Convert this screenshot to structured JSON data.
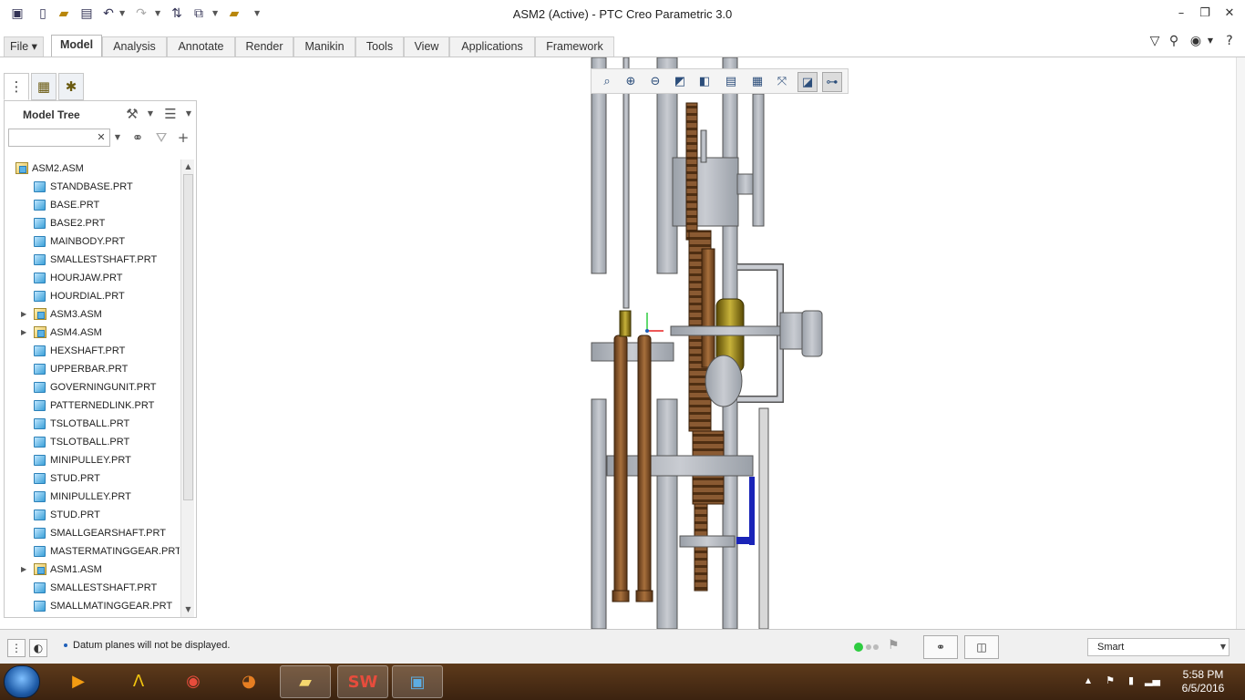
{
  "app": {
    "title": "ASM2 (Active) - PTC Creo Parametric 3.0"
  },
  "quick_access": {
    "icons": [
      "window-icon",
      "new-file-icon",
      "open-icon",
      "save-icon",
      "undo-icon",
      "redo-icon",
      "regenerate-icon",
      "windows-icon",
      "close-icon",
      "customize-icon"
    ]
  },
  "ribbon": {
    "tabs": [
      {
        "label": "File ▾",
        "id": "file"
      },
      {
        "label": "Model",
        "id": "model"
      },
      {
        "label": "Analysis",
        "id": "analysis"
      },
      {
        "label": "Annotate",
        "id": "annotate"
      },
      {
        "label": "Render",
        "id": "render"
      },
      {
        "label": "Manikin",
        "id": "manikin"
      },
      {
        "label": "Tools",
        "id": "tools"
      },
      {
        "label": "View",
        "id": "view"
      },
      {
        "label": "Applications",
        "id": "applications"
      },
      {
        "label": "Framework",
        "id": "framework"
      }
    ],
    "active_tab": "Model"
  },
  "model_tree": {
    "header": "Model Tree",
    "search": {
      "value": "",
      "placeholder": ""
    },
    "items": [
      {
        "label": "ASM2.ASM",
        "type": "asm",
        "level": 0,
        "expandable": false
      },
      {
        "label": "STANDBASE.PRT",
        "type": "prt",
        "level": 1,
        "expandable": false
      },
      {
        "label": "BASE.PRT",
        "type": "prt",
        "level": 1,
        "expandable": false
      },
      {
        "label": "BASE2.PRT",
        "type": "prt",
        "level": 1,
        "expandable": false
      },
      {
        "label": "MAINBODY.PRT",
        "type": "prt",
        "level": 1,
        "expandable": false
      },
      {
        "label": "SMALLESTSHAFT.PRT",
        "type": "prt",
        "level": 1,
        "expandable": false
      },
      {
        "label": "HOURJAW.PRT",
        "type": "prt",
        "level": 1,
        "expandable": false
      },
      {
        "label": "HOURDIAL.PRT",
        "type": "prt",
        "level": 1,
        "expandable": false
      },
      {
        "label": "ASM3.ASM",
        "type": "asm",
        "level": 1,
        "expandable": true
      },
      {
        "label": "ASM4.ASM",
        "type": "asm",
        "level": 1,
        "expandable": true
      },
      {
        "label": "HEXSHAFT.PRT",
        "type": "prt",
        "level": 1,
        "expandable": false
      },
      {
        "label": "UPPERBAR.PRT",
        "type": "prt",
        "level": 1,
        "expandable": false
      },
      {
        "label": "GOVERNINGUNIT.PRT",
        "type": "prt",
        "level": 1,
        "expandable": false
      },
      {
        "label": "PATTERNEDLINK.PRT",
        "type": "prt",
        "level": 1,
        "expandable": false
      },
      {
        "label": "TSLOTBALL.PRT",
        "type": "prt",
        "level": 1,
        "expandable": false
      },
      {
        "label": "TSLOTBALL.PRT",
        "type": "prt",
        "level": 1,
        "expandable": false
      },
      {
        "label": "MINIPULLEY.PRT",
        "type": "prt",
        "level": 1,
        "expandable": false
      },
      {
        "label": "STUD.PRT",
        "type": "prt",
        "level": 1,
        "expandable": false
      },
      {
        "label": "MINIPULLEY.PRT",
        "type": "prt",
        "level": 1,
        "expandable": false
      },
      {
        "label": "STUD.PRT",
        "type": "prt",
        "level": 1,
        "expandable": false
      },
      {
        "label": "SMALLGEARSHAFT.PRT",
        "type": "prt",
        "level": 1,
        "expandable": false
      },
      {
        "label": "MASTERMATINGGEAR.PRT",
        "type": "prt",
        "level": 1,
        "expandable": false
      },
      {
        "label": "ASM1.ASM",
        "type": "asm",
        "level": 1,
        "expandable": true
      },
      {
        "label": "SMALLESTSHAFT.PRT",
        "type": "prt",
        "level": 1,
        "expandable": false
      },
      {
        "label": "SMALLMATINGGEAR.PRT",
        "type": "prt",
        "level": 1,
        "expandable": false
      }
    ]
  },
  "view_toolbar": {
    "buttons": [
      "refit-icon",
      "zoom-in-icon",
      "zoom-out-icon",
      "repaint-icon",
      "display-style-icon",
      "saved-orientations-icon",
      "view-manager-icon",
      "datum-display-icon",
      "annotation-display-icon",
      "spin-center-icon"
    ]
  },
  "status": {
    "message": "Datum planes will not be displayed.",
    "selection_filter": "Smart"
  },
  "taskbar": {
    "time": "5:58 PM",
    "date": "6/5/2016"
  },
  "colors": {
    "model_gray": "#b9bdc4",
    "model_copper": "#8a5a32",
    "model_gold": "#8c7a10",
    "accent_blue": "#1f5fb8"
  }
}
